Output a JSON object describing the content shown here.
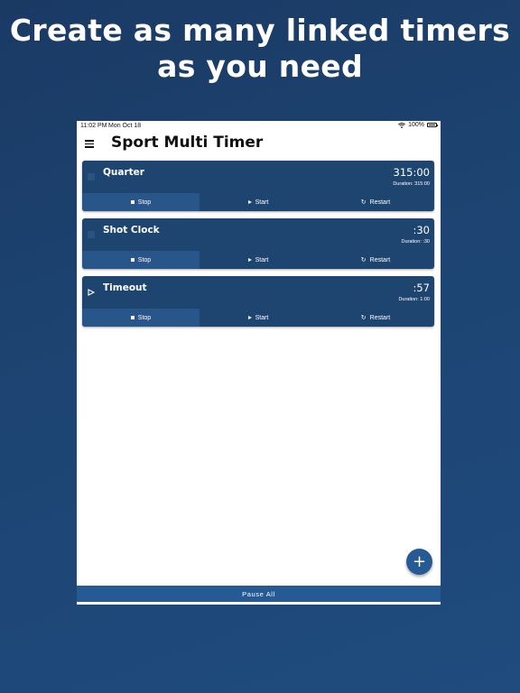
{
  "headline": "Create as many linked timers as you need",
  "status_bar": {
    "time": "11:02 PM",
    "date": "Mon Oct 18",
    "battery": "100%"
  },
  "app_bar": {
    "title": "Sport Multi Timer",
    "menu_icon": "hamburger-menu-icon"
  },
  "timers": [
    {
      "name": "Quarter",
      "value": "315:00",
      "duration": "Duration: 315:00",
      "state_icon": "stopped-square-icon",
      "controls": {
        "stop": "Stop",
        "start": "Start",
        "restart": "Restart"
      }
    },
    {
      "name": "Shot Clock",
      "value": ":30",
      "duration": "Duration: :30",
      "state_icon": "stopped-square-icon",
      "controls": {
        "stop": "Stop",
        "start": "Start",
        "restart": "Restart"
      }
    },
    {
      "name": "Timeout",
      "value": ":57",
      "duration": "Duration: 1:00",
      "state_icon": "running-play-icon",
      "controls": {
        "stop": "Stop",
        "start": "Start",
        "restart": "Restart"
      }
    }
  ],
  "fab": {
    "label": "+"
  },
  "footer": {
    "pause_all": "Pause All"
  },
  "colors": {
    "background": "#1d4472",
    "card": "#1e4470",
    "accent": "#255a94",
    "active_control": "#28558a"
  }
}
